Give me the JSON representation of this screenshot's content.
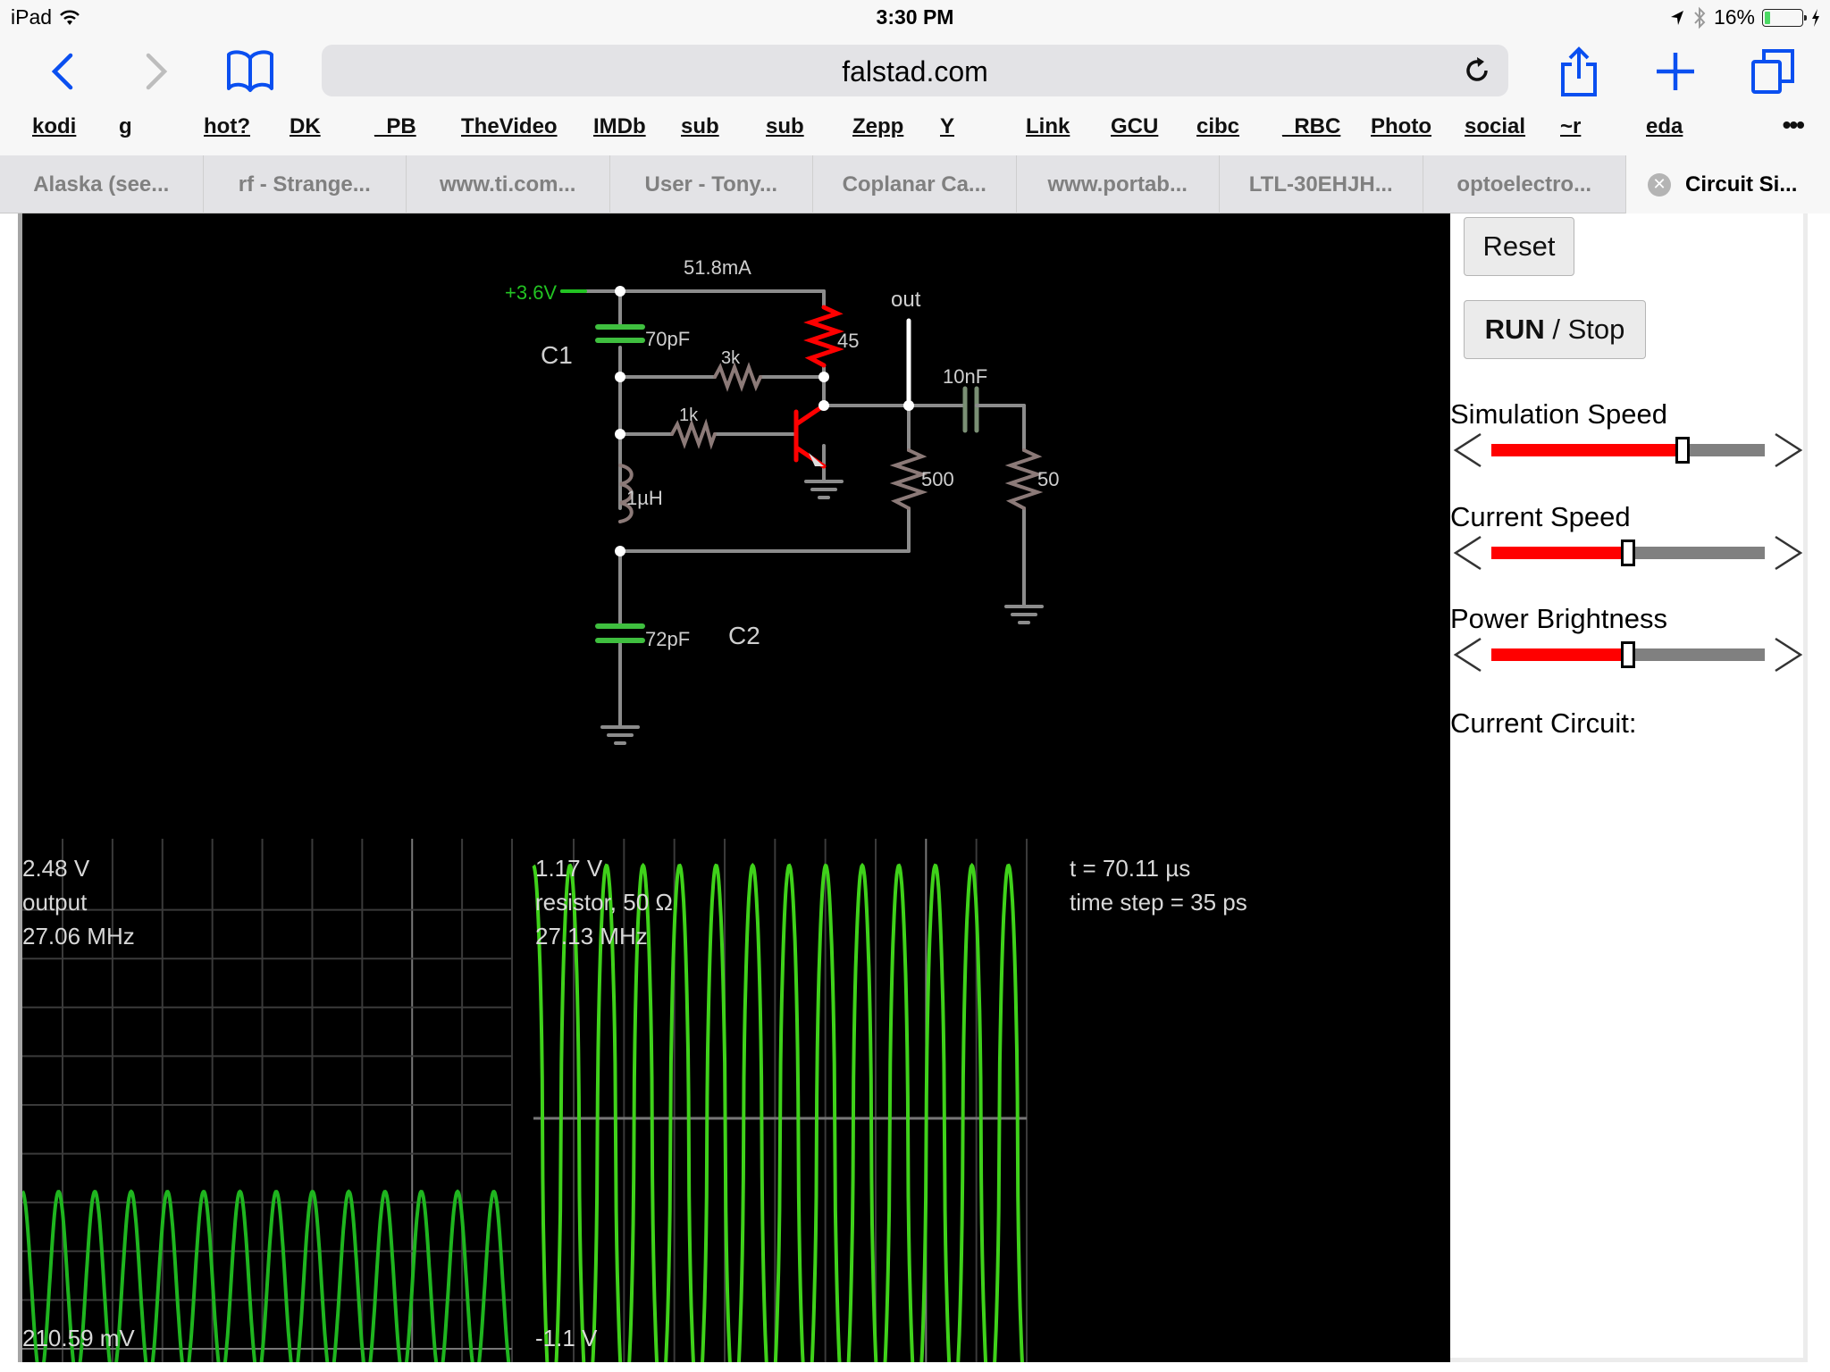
{
  "status_bar": {
    "device": "iPad",
    "time": "3:30 PM",
    "battery_percent": "16%",
    "battery_level": 0.16
  },
  "browser": {
    "url": "falstad.com",
    "bookmarks": [
      "kodi",
      "g",
      "hot?",
      "DK",
      "_PB",
      "TheVideo",
      "IMDb",
      "sub",
      "sub",
      "Zepp",
      "Y",
      "Link",
      "GCU",
      "cibc",
      "_RBC",
      "Photo",
      "social",
      "~r",
      "eda"
    ],
    "more_label": "•••",
    "tabs": [
      {
        "title": "Alaska (see..."
      },
      {
        "title": "rf - Strange..."
      },
      {
        "title": "www.ti.com..."
      },
      {
        "title": "User - Tony..."
      },
      {
        "title": "Coplanar Ca..."
      },
      {
        "title": "www.portab..."
      },
      {
        "title": "LTL-30EHJH..."
      },
      {
        "title": "optoelectro..."
      },
      {
        "title": "Circuit Si...",
        "active": true
      }
    ]
  },
  "circuit": {
    "supply_label": "+3.6V",
    "supply_current": "51.8mA",
    "out_label": "out",
    "components": {
      "c1_name": "C1",
      "c1_value": "70pF",
      "c2_name": "C2",
      "c2_value": "72pF",
      "r_feedback": "3k",
      "r_base": "1k",
      "r_collector": "45",
      "inductor": "1µH",
      "coupling_cap": "10nF",
      "r_load1": "500",
      "r_load2": "50"
    },
    "colors": {
      "wire": "#8c8c8c",
      "node": "#ffffff",
      "hot": "#ff0000",
      "cap": "#3fbf3f",
      "resistor": "#8c7a78",
      "supply": "#22c322",
      "trace": "#33dd00"
    }
  },
  "scopes": [
    {
      "max_label": "2.48 V",
      "name": "output",
      "freq": "27.06 MHz",
      "min_label": "210.59 mV",
      "cycles_visible": 13.5
    },
    {
      "max_label": "1.17 V",
      "name": "resistor, 50 Ω",
      "freq": "27.13 MHz",
      "min_label": "-1.1 V",
      "cycles_visible": 13.5
    }
  ],
  "sim_info": {
    "time": "t = 70.11 µs",
    "time_step": "time step = 35 ps"
  },
  "panel": {
    "reset_label": "Reset",
    "run_label_bold": "RUN",
    "run_label_rest": " / Stop",
    "sliders": [
      {
        "label": "Simulation Speed",
        "value": 0.7
      },
      {
        "label": "Current Speed",
        "value": 0.5
      },
      {
        "label": "Power Brightness",
        "value": 0.5
      }
    ],
    "current_circuit_label": "Current Circuit:"
  }
}
